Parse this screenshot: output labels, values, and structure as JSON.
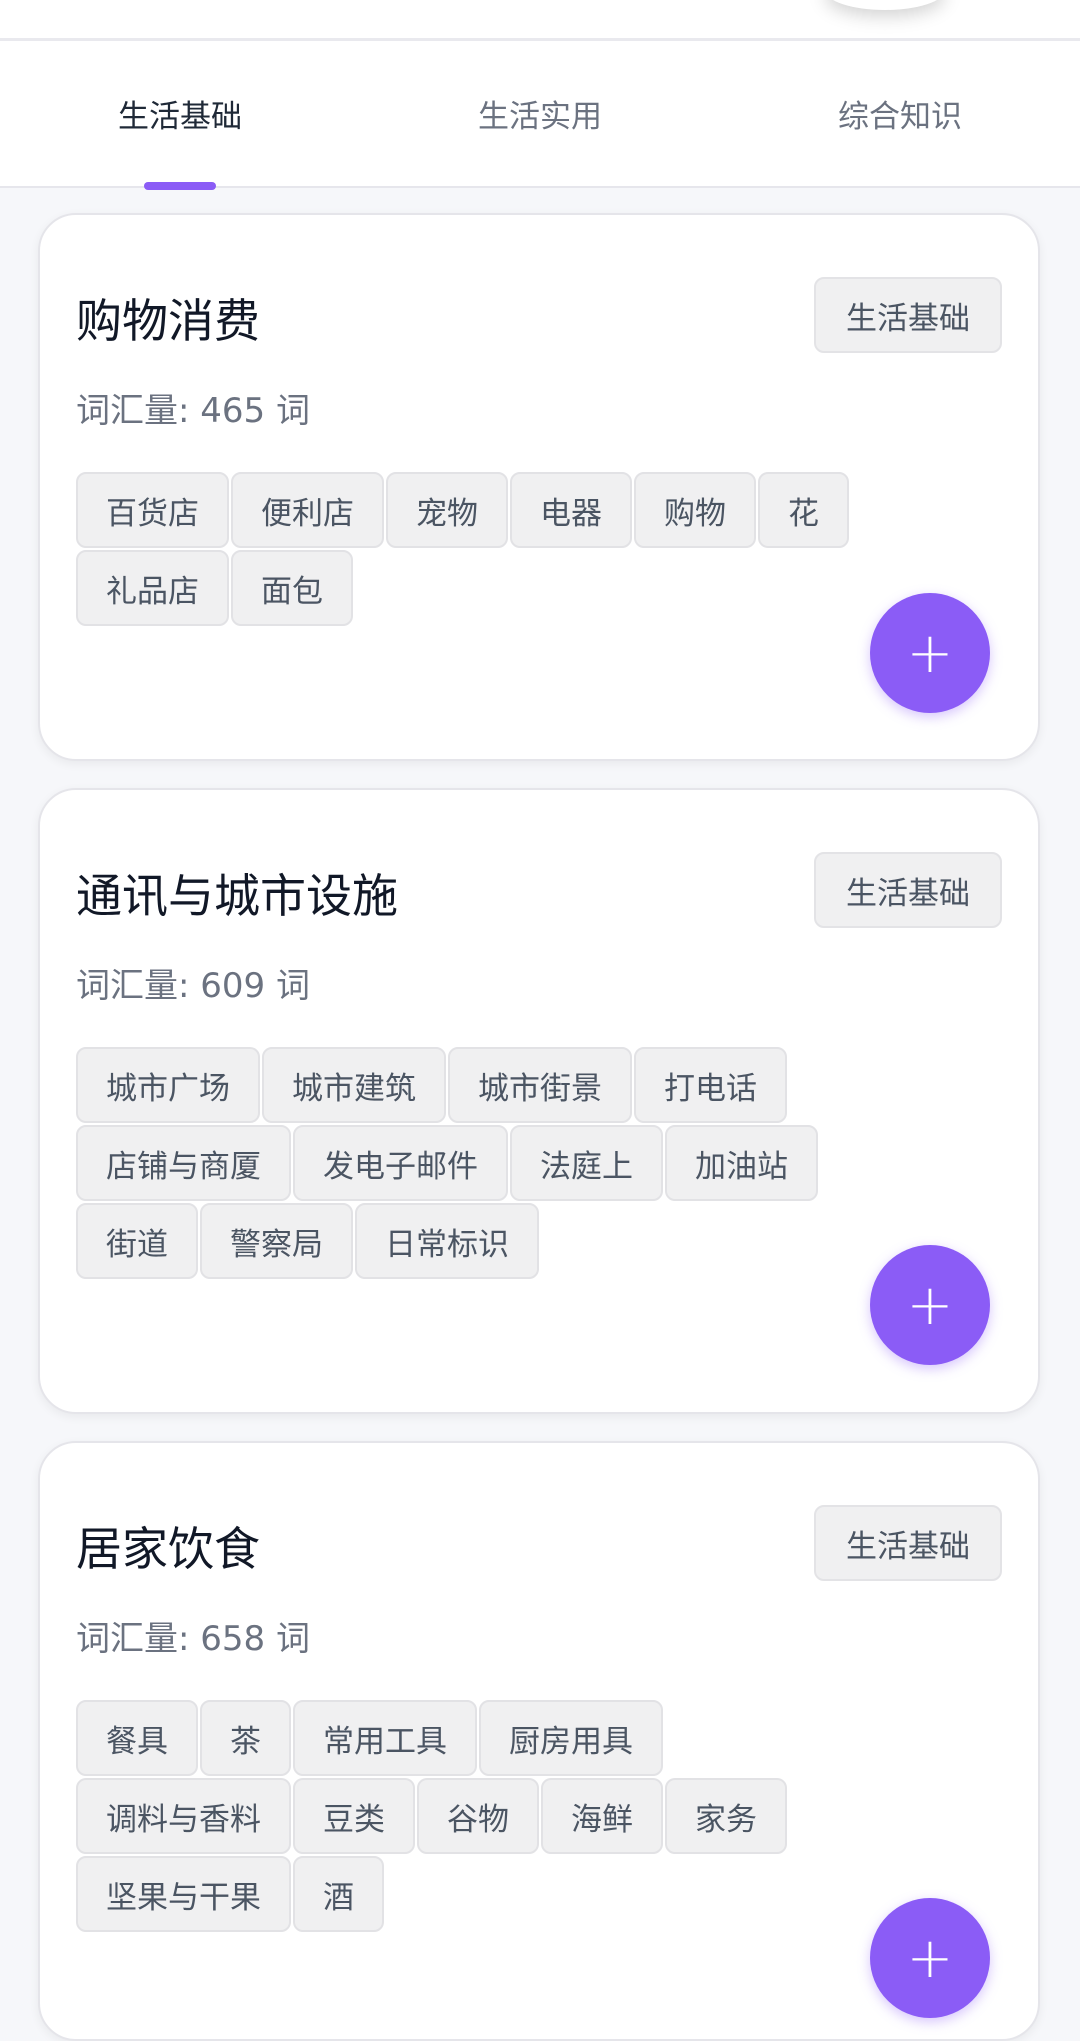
{
  "tabs": [
    {
      "label": "生活基础"
    },
    {
      "label": "生活实用"
    },
    {
      "label": "综合知识"
    }
  ],
  "accent_color": "#8b5cf6",
  "cards": [
    {
      "title": "购物消费",
      "badge": "生活基础",
      "count_text": "词汇量: 465 词",
      "tags": [
        "百货店",
        "便利店",
        "宠物",
        "电器",
        "购物",
        "花",
        "礼品店",
        "面包"
      ],
      "add_icon": "+"
    },
    {
      "title": "通讯与城市设施",
      "badge": "生活基础",
      "count_text": "词汇量: 609 词",
      "tags": [
        "城市广场",
        "城市建筑",
        "城市街景",
        "打电话",
        "店铺与商厦",
        "发电子邮件",
        "法庭上",
        "加油站",
        "街道",
        "警察局",
        "日常标识"
      ],
      "add_icon": "+"
    },
    {
      "title": "居家饮食",
      "badge": "生活基础",
      "count_text": "词汇量: 658 词",
      "tags": [
        "餐具",
        "茶",
        "常用工具",
        "厨房用具",
        "调料与香料",
        "豆类",
        "谷物",
        "海鲜",
        "家务",
        "坚果与干果",
        "酒"
      ],
      "add_icon": "+"
    }
  ]
}
